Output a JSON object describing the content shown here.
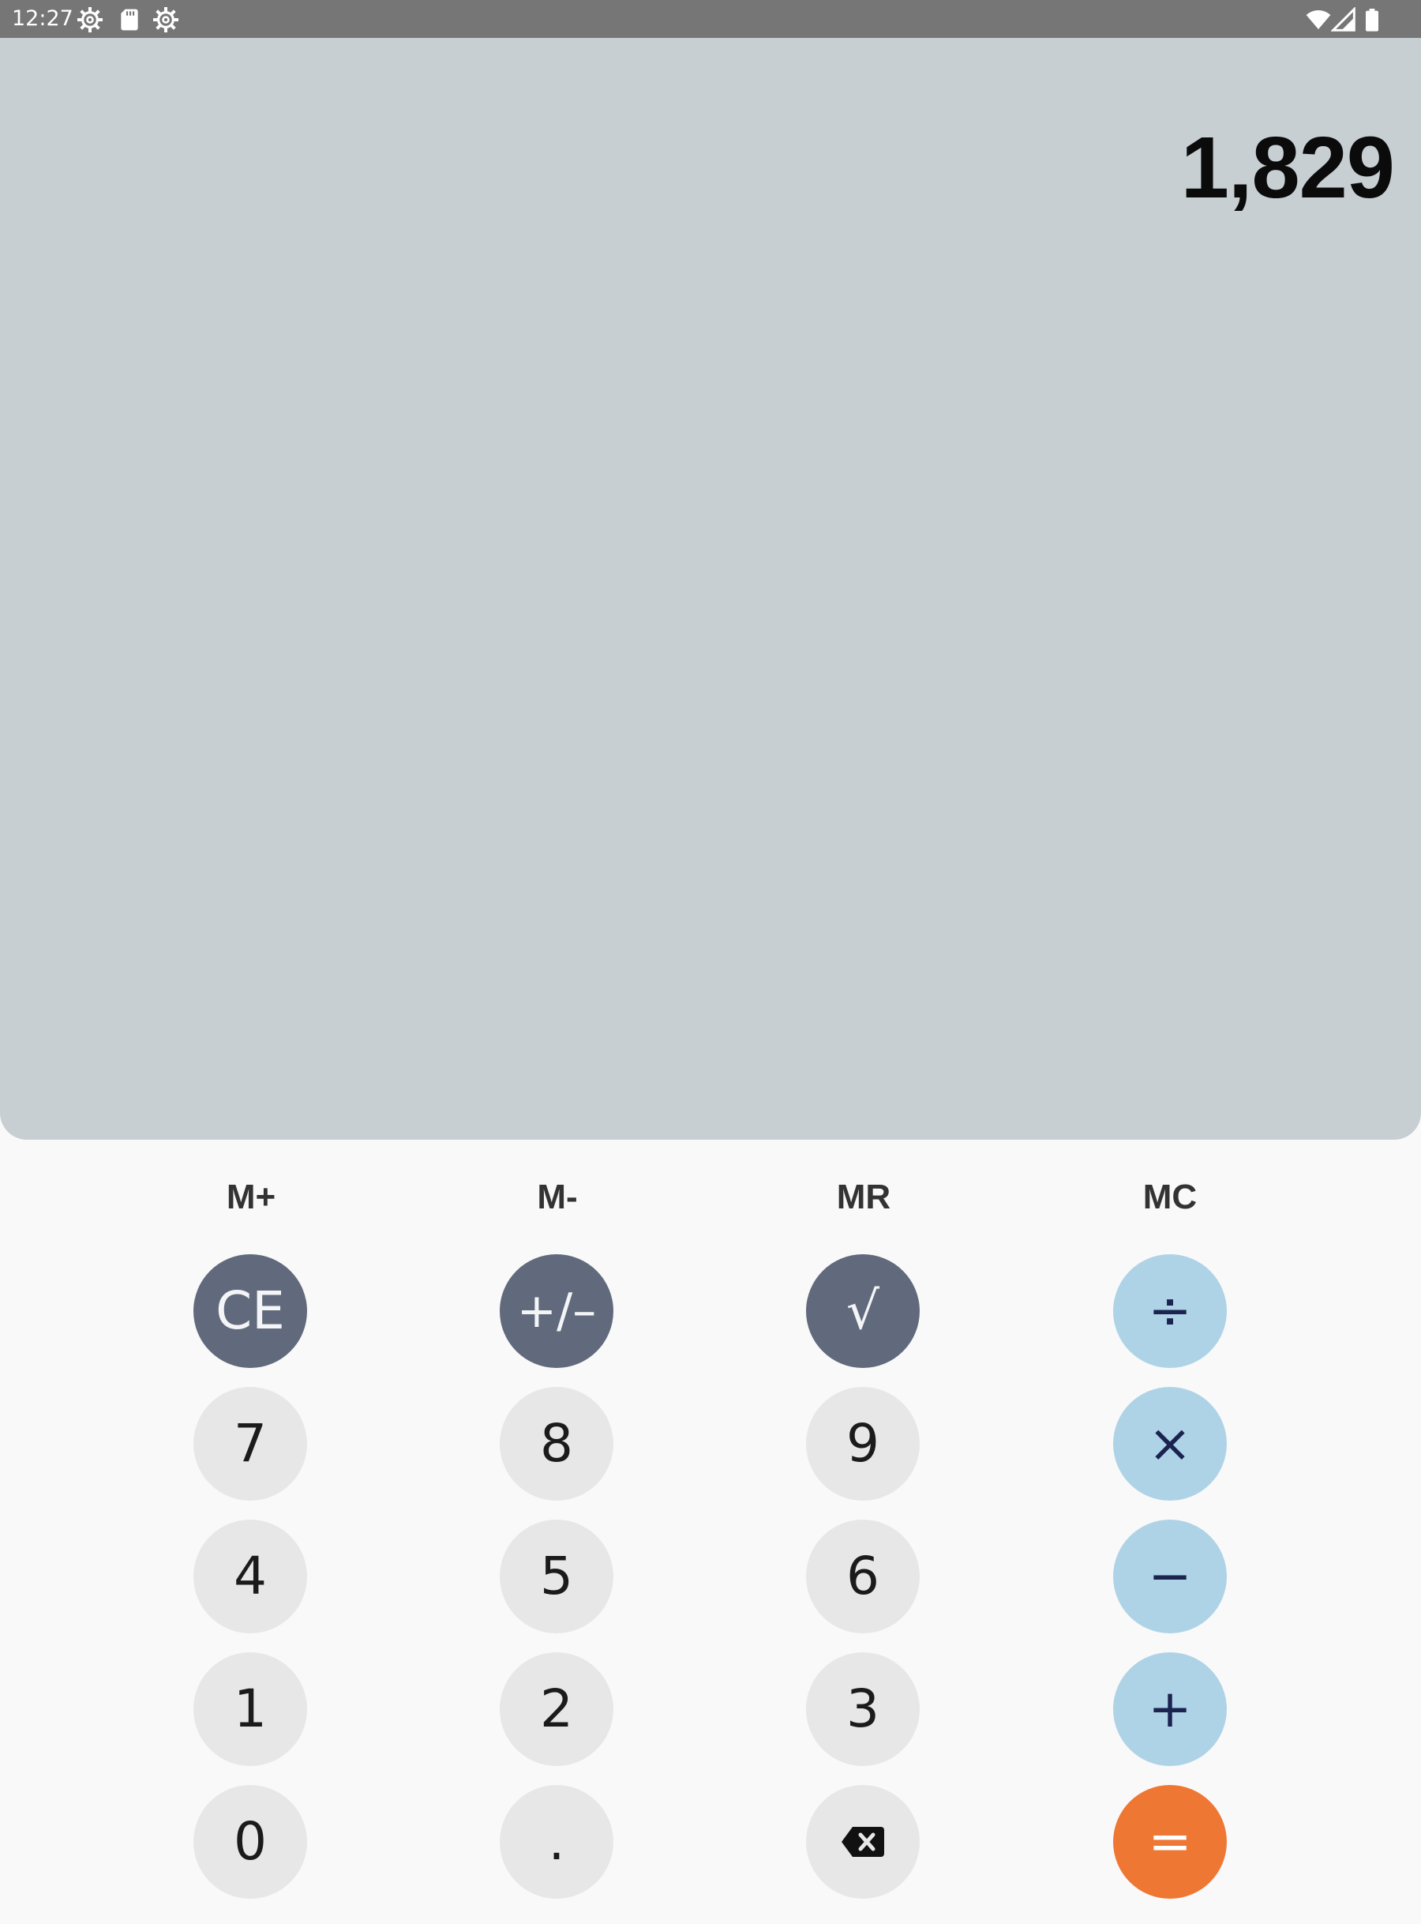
{
  "status_bar": {
    "time": "12:27",
    "left_icons": [
      "gear-icon",
      "sd-card-icon",
      "gear-icon"
    ],
    "right_icons": [
      "wifi-icon",
      "cellular-signal-icon",
      "battery-icon"
    ]
  },
  "display": {
    "value": "1,829"
  },
  "memory": {
    "m_plus": "M+",
    "m_minus": "M-",
    "mr": "MR",
    "mc": "MC"
  },
  "keys": {
    "ce": "CE",
    "plus_minus": "+/–",
    "sqrt": "√",
    "divide": "÷",
    "seven": "7",
    "eight": "8",
    "nine": "9",
    "multiply": "×",
    "four": "4",
    "five": "5",
    "six": "6",
    "minus": "−",
    "one": "1",
    "two": "2",
    "three": "3",
    "plus": "+",
    "zero": "0",
    "decimal": ".",
    "backspace_icon": "backspace-icon",
    "equals": "="
  },
  "colors": {
    "status_bar": "#767676",
    "display_bg": "#c7cfd3",
    "function_key": "#616a7c",
    "digit_key": "#e7e7e7",
    "operator_key": "#afd3e6",
    "equals_key": "#ef7734"
  }
}
